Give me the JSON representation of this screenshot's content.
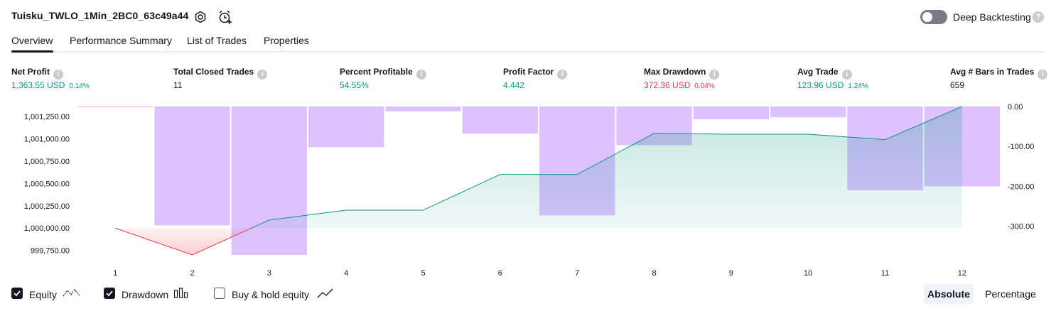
{
  "header": {
    "strategy_title": "Tuisku_TWLO_1Min_2BC0_63c49a44",
    "deep_backtesting_label": "Deep Backtesting",
    "deep_backtesting_enabled": false,
    "help_glyph": "?"
  },
  "tabs": [
    {
      "label": "Overview",
      "active": true
    },
    {
      "label": "Performance Summary",
      "active": false
    },
    {
      "label": "List of Trades",
      "active": false
    },
    {
      "label": "Properties",
      "active": false
    }
  ],
  "metrics": [
    {
      "label": "Net Profit",
      "value": "1,363.55 USD",
      "pct": "0.14%",
      "color": "#089981"
    },
    {
      "label": "Total Closed Trades",
      "value": "11",
      "pct": "",
      "color": "#131722"
    },
    {
      "label": "Percent Profitable",
      "value": "54.55%",
      "pct": "",
      "color": "#089981"
    },
    {
      "label": "Profit Factor",
      "value": "4.442",
      "pct": "",
      "color": "#089981"
    },
    {
      "label": "Max Drawdown",
      "value": "372.36 USD",
      "pct": "0.04%",
      "color": "#f23645"
    },
    {
      "label": "Avg Trade",
      "value": "123.96 USD",
      "pct": "1.24%",
      "color": "#089981"
    },
    {
      "label": "Avg # Bars in Trades",
      "value": "659",
      "pct": "",
      "color": "#131722"
    }
  ],
  "chart_data": {
    "type": "line",
    "x": [
      1,
      2,
      3,
      4,
      5,
      6,
      7,
      8,
      9,
      10,
      11,
      12
    ],
    "series": [
      {
        "name": "Equity",
        "axis": "left",
        "values": [
          1000000,
          999700,
          1000090,
          1000200,
          1000200,
          1000600,
          1000600,
          1001060,
          1001050,
          1001050,
          1000990,
          1001360
        ],
        "color_up": "#089981",
        "color_down": "#f23645"
      },
      {
        "name": "Drawdown",
        "axis": "right",
        "chart_type": "bar",
        "values": [
          0,
          -298,
          -372,
          -102,
          -12,
          -68,
          -273,
          -97,
          -32,
          -27,
          -210,
          -200
        ],
        "color": "#c799ff"
      }
    ],
    "left_ticks": [
      "1,001,250.00",
      "1,001,000.00",
      "1,000,750.00",
      "1,000,500.00",
      "1,000,250.00",
      "1,000,000.00",
      "999,750.00"
    ],
    "right_ticks": [
      "0.00",
      "-100.00",
      "-200.00",
      "-300.00"
    ],
    "left_ylim": [
      999700,
      1001360
    ],
    "right_ylim": [
      -372,
      0
    ],
    "baseline": 1000000,
    "grid": false
  },
  "legend": {
    "equity_label": "Equity",
    "equity_checked": true,
    "drawdown_label": "Drawdown",
    "drawdown_checked": true,
    "buyhold_label": "Buy & hold equity",
    "buyhold_checked": false
  },
  "mode_toggle": {
    "absolute_label": "Absolute",
    "percentage_label": "Percentage",
    "selected": "Absolute"
  }
}
